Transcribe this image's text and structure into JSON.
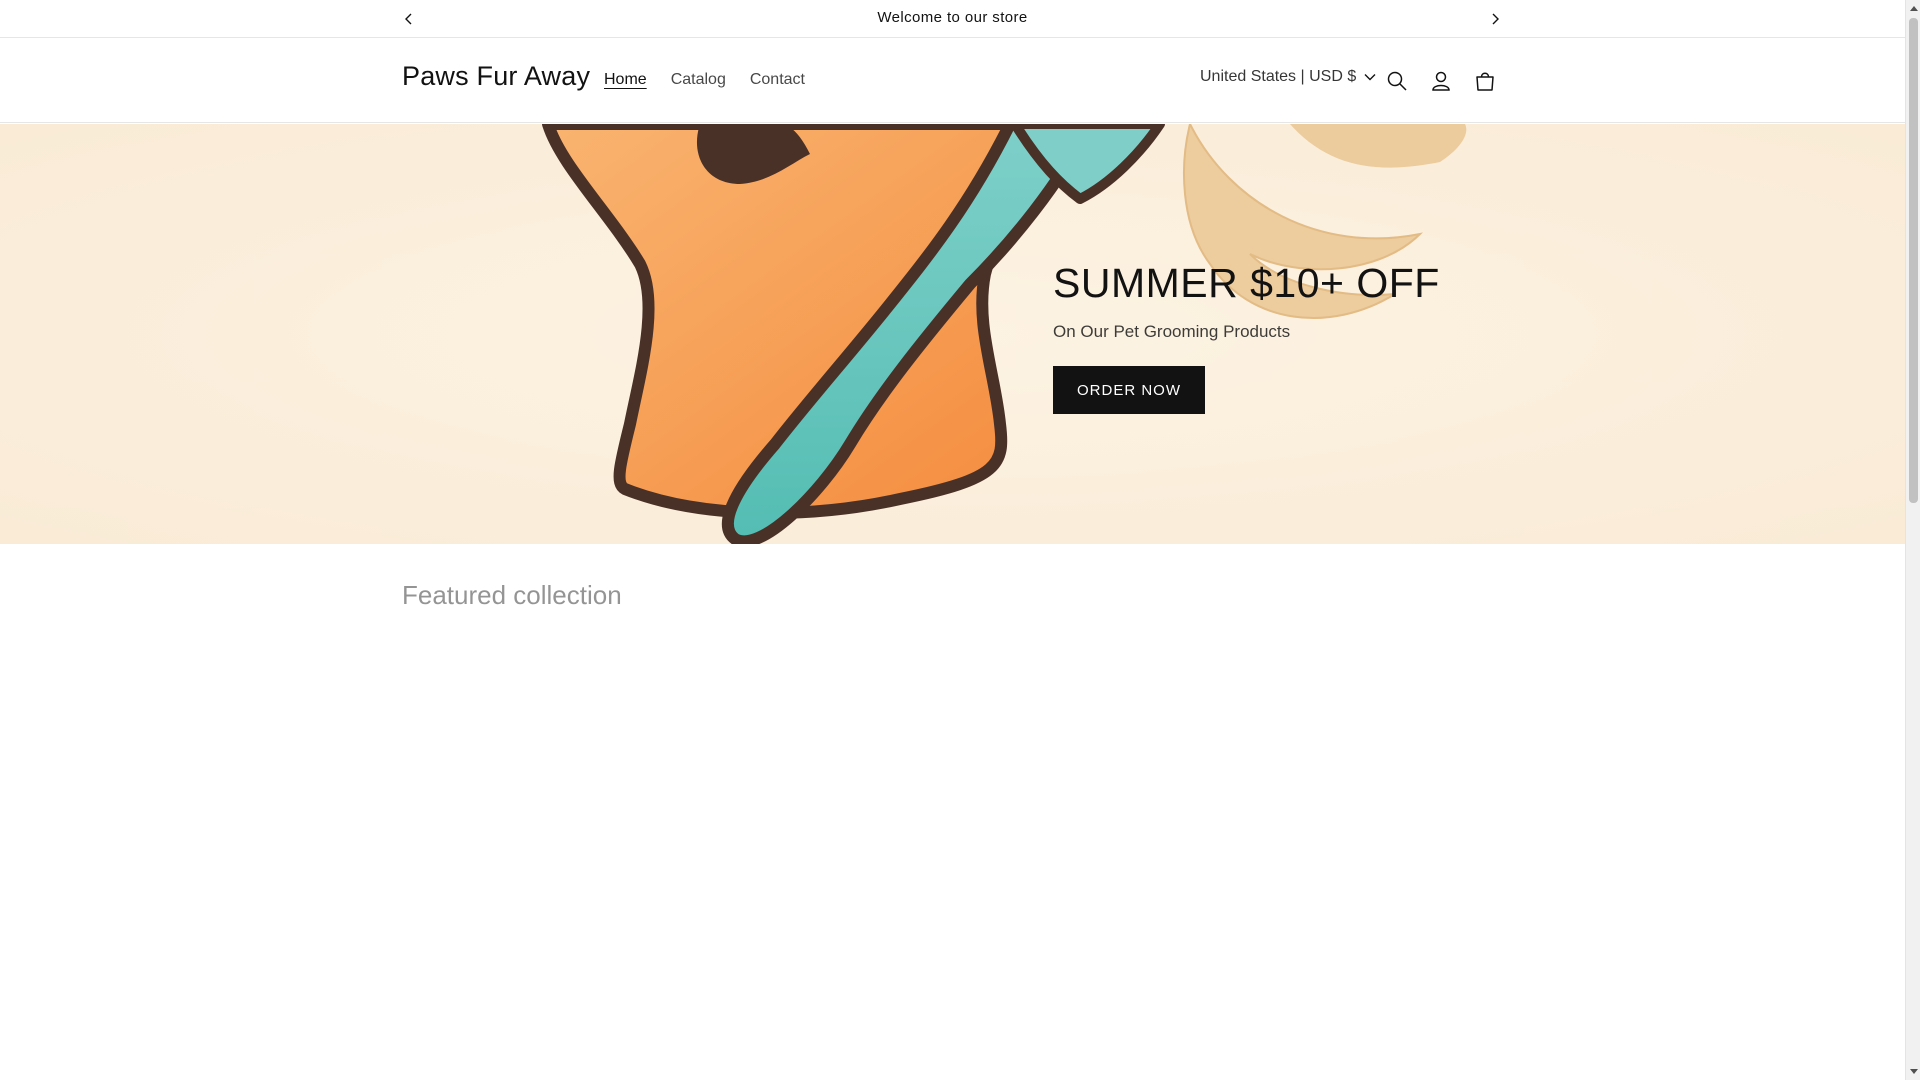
{
  "announcement": {
    "message": "Welcome to our store",
    "prev_icon": "chevron-left-icon",
    "next_icon": "chevron-right-icon"
  },
  "header": {
    "logo": "Paws Fur Away",
    "nav": [
      {
        "label": "Home",
        "active": true
      },
      {
        "label": "Catalog",
        "active": false
      },
      {
        "label": "Contact",
        "active": false
      }
    ],
    "locale_label": "United States | USD $",
    "icons": [
      "search-icon",
      "account-icon",
      "cart-icon"
    ]
  },
  "hero": {
    "title": "SUMMER $10+ OFF",
    "subtitle": "On Our Pet Grooming Products",
    "cta_label": "ORDER NOW"
  },
  "featured": {
    "title": "Featured collection"
  },
  "colors": {
    "text": "#121212",
    "button_bg": "#121212",
    "button_text": "#ffffff",
    "hero_bg": "#fbf0de",
    "paw_orange": "#f7a25e",
    "brush_teal": "#5bbfb5",
    "outline_brown": "#4a3128",
    "accent_tan": "#eccb9c"
  }
}
